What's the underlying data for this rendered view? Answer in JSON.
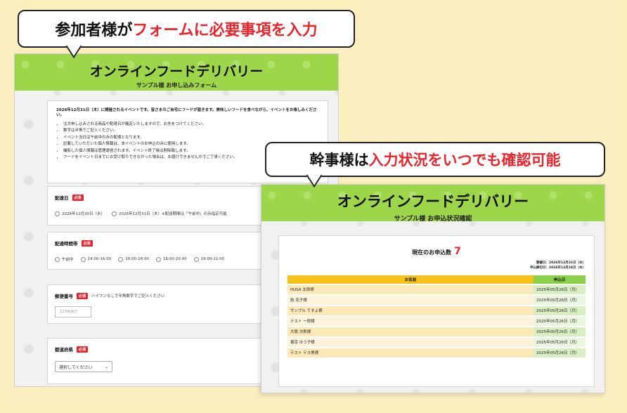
{
  "bubble_top": {
    "prefix": "参加者様が",
    "highlight": "フォームに必要事項を入力"
  },
  "bubble_bottom": {
    "prefix": "幹事様は",
    "highlight": "入力状況をいつでも確認可能"
  },
  "form": {
    "title": "オンラインフードデリバリー",
    "subtitle": "サンプル様 お申し込みフォーム",
    "notice_lead": "2026年12月31日（木）に開催されるイベントです。皆さまのご自宅にフードが届きます。美味しいフードを食べながら、イベントをお楽しみください。",
    "notice_items": [
      "注文申し込みされる商品や配達日が確定いたしますので、お先をつけてください。",
      "数字は半角でご記入ください。",
      "イベント当日は午前中のみの配達となります。",
      "記載していただいた個人情報は、本イベントのお申込のみに使用します。",
      "撮影した個人情報は管理運営されます。イベント終了後は削除致します。",
      "フードをイベント日までにお受け取りできなかった場合は、お届けできませんのでご了承ください。"
    ],
    "required_label": "必須",
    "delivery_date": {
      "label": "配達日",
      "options": [
        "2026年12月30日（水）",
        "2026年12月31日（木）※配送期間は「午前中」のみ指定可能"
      ]
    },
    "delivery_time": {
      "label": "配達時間帯",
      "options": [
        "午前中",
        "14:00-16:00",
        "16:00-18:00",
        "18:00-20:00",
        "19:00-21:00"
      ]
    },
    "postal_code": {
      "label": "郵便番号",
      "hint": "ハイフンなしで半角数字でご記入ください",
      "placeholder": "1234567"
    },
    "prefecture": {
      "label": "都道府県",
      "select_value": "選択してください"
    }
  },
  "status": {
    "title": "オンラインフードデリバリー",
    "subtitle": "サンプル様 お申込状況確認",
    "count_label": "現在のお申込数",
    "count_value": "7",
    "meta_lines": [
      "開催日：2026年12月31日（木）",
      "申込締切日：2026年12月24日（木）"
    ],
    "columns": [
      "お名前",
      "申込日"
    ],
    "rows": [
      {
        "name": "HUSA 太郎様",
        "date": "2025年05月26日（月）"
      },
      {
        "name": "航 花子様",
        "date": "2025年05月26日（月）"
      },
      {
        "name": "サンプル てすよ様",
        "date": "2025年05月26日（月）"
      },
      {
        "name": "テスト 一郎様",
        "date": "2025年05月26日（月）"
      },
      {
        "name": "大阪 次郎様",
        "date": "2025年05月26日（月）"
      },
      {
        "name": "東京 ゆう子様",
        "date": "2025年05月26日（月）"
      },
      {
        "name": "テスト テス男様",
        "date": "2025年05月26日（月）"
      }
    ]
  },
  "colors": {
    "accent_green": "#9ed64a",
    "highlight_red": "#e8242c",
    "header_yellow": "#f5c21a",
    "background": "#fdf0bf"
  }
}
